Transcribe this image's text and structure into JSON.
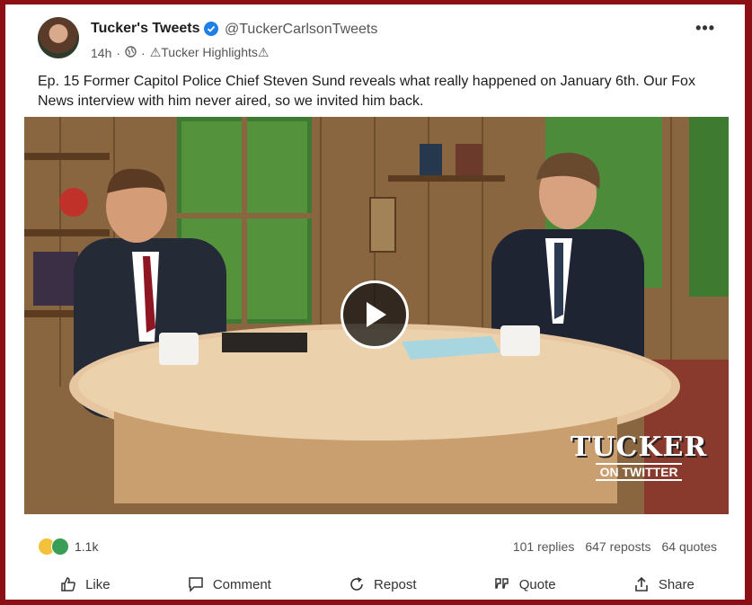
{
  "post": {
    "author_name": "Tucker's Tweets",
    "author_handle": "@TuckerCarlsonTweets",
    "time": "14h",
    "separator": "·",
    "group": "⚠Tucker Highlights⚠",
    "more_label": "•••",
    "text": "Ep. 15 Former Capitol Police Chief Steven Sund reveals what really happened on January 6th. Our Fox News interview with him never aired, so we invited him back."
  },
  "video": {
    "watermark_main": "TUCKER",
    "watermark_sub": "ON TWITTER"
  },
  "stats": {
    "reaction_count": "1.1k",
    "replies": "101 replies",
    "reposts": "647 reposts",
    "quotes": "64 quotes"
  },
  "actions": {
    "like": "Like",
    "comment": "Comment",
    "repost": "Repost",
    "quote": "Quote",
    "share": "Share"
  },
  "colors": {
    "frame": "#8b0f14",
    "verified": "#1d80e6"
  }
}
